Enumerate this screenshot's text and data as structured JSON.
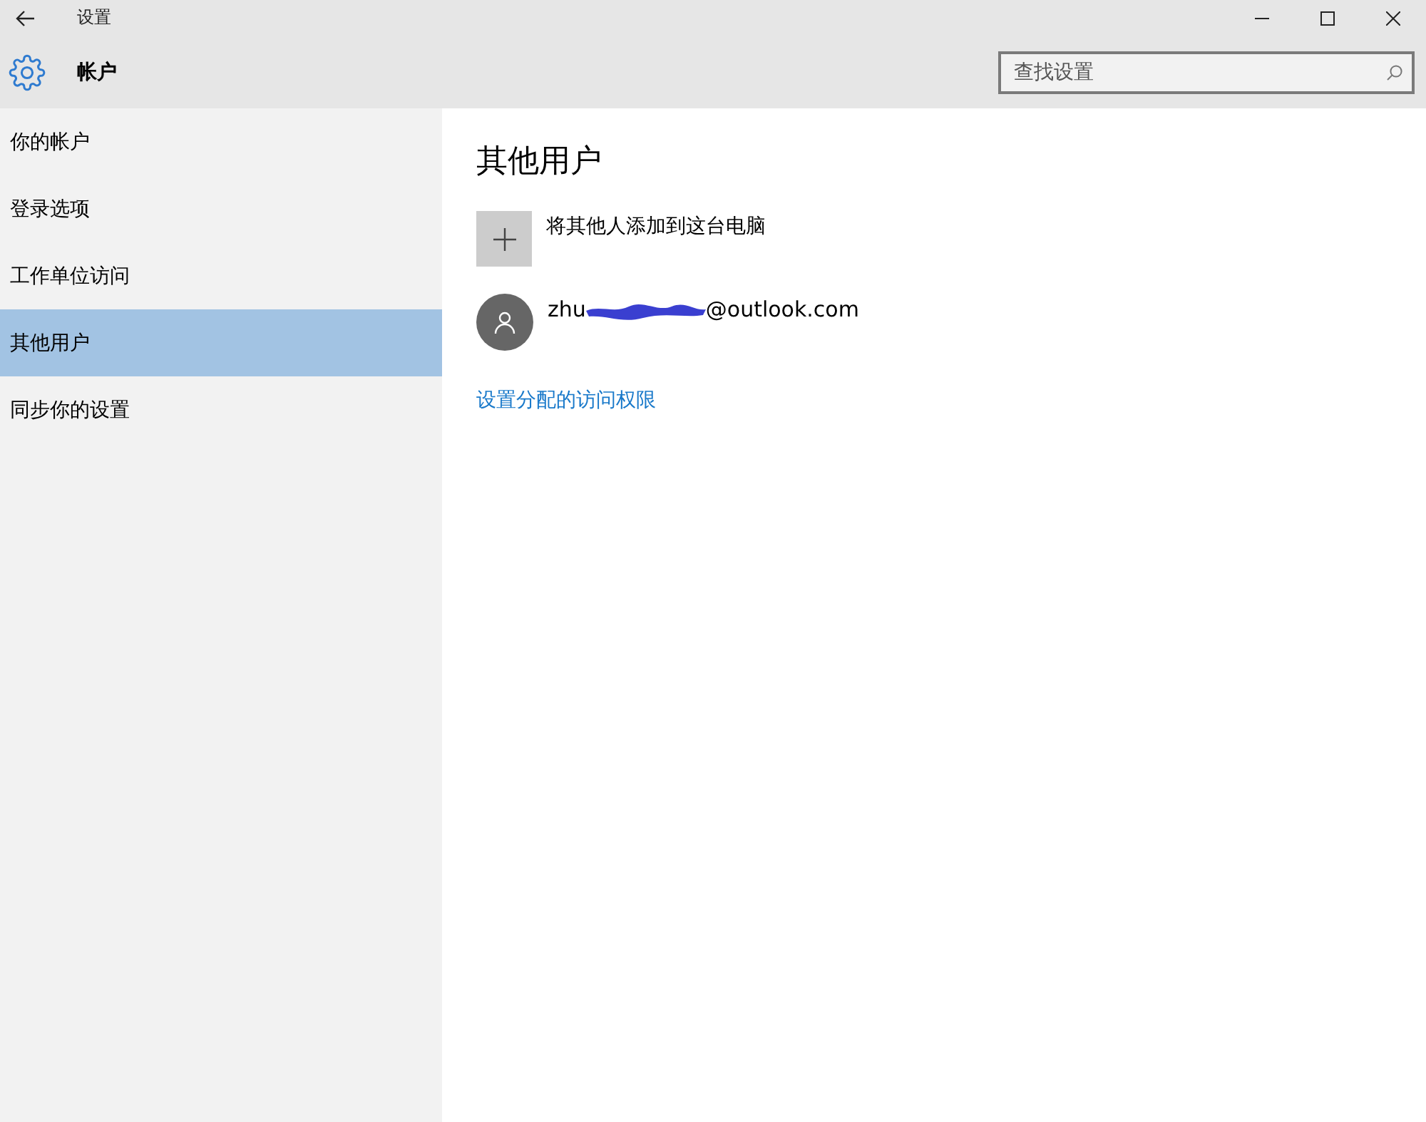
{
  "window": {
    "title": "设置"
  },
  "header": {
    "title": "帐户",
    "search": {
      "placeholder": "查找设置"
    }
  },
  "sidebar": {
    "items": [
      {
        "label": "你的帐户",
        "selected": false
      },
      {
        "label": "登录选项",
        "selected": false
      },
      {
        "label": "工作单位访问",
        "selected": false
      },
      {
        "label": "其他用户",
        "selected": true
      },
      {
        "label": "同步你的设置",
        "selected": false
      }
    ]
  },
  "content": {
    "heading": "其他用户",
    "add_user": "将其他人添加到这台电脑",
    "accounts": [
      {
        "email_start": "zhu",
        "email_end": "@outlook.com"
      }
    ],
    "link": "设置分配的访问权限"
  }
}
